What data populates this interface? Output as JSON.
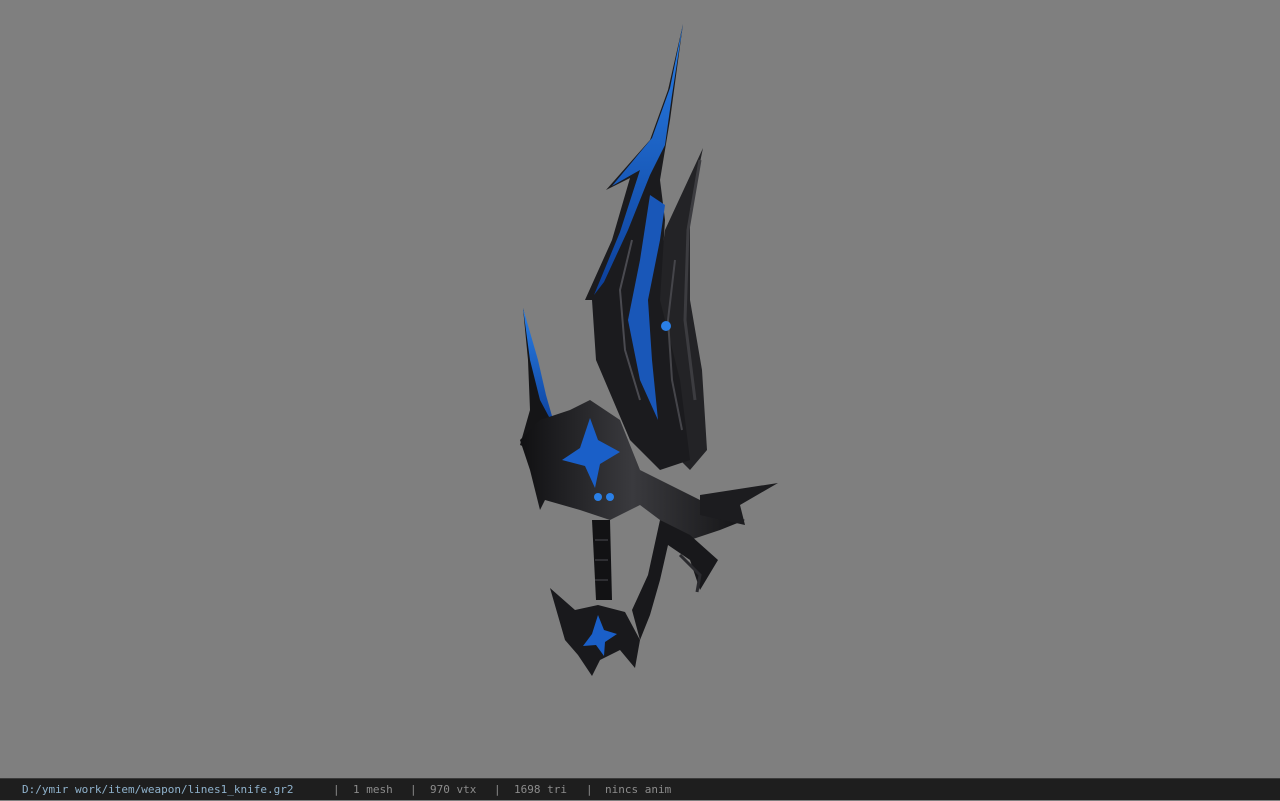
{
  "status_bar": {
    "file_path": "D:/ymir work/item/weapon/lines1_knife.gr2",
    "separator": "|",
    "mesh_count": "1 mesh",
    "vertex_count": "970 vtx",
    "triangle_count": "1698 tri",
    "anim_status": "nincs anim"
  },
  "viewport": {
    "background_color": "#7f7f7f",
    "model_primary_color": "#1f1f22",
    "model_accent_color": "#1a5fc8"
  }
}
